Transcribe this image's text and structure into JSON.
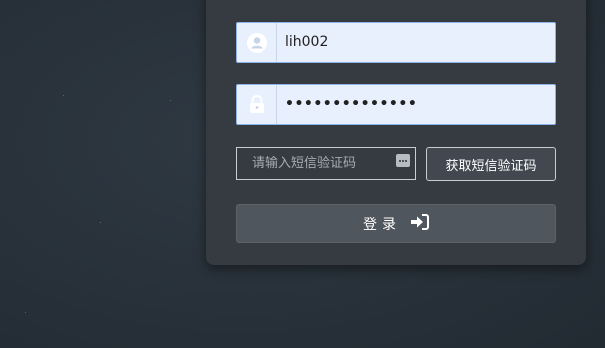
{
  "login_form": {
    "username": {
      "value": "lih002",
      "icon": "user-circle-icon"
    },
    "password": {
      "value": "••••••••••••••",
      "icon": "lock-icon"
    },
    "sms_code": {
      "placeholder": "请输入短信验证码",
      "icon": "keyboard-dots-icon"
    },
    "get_sms_button": {
      "label": "获取短信验证码"
    },
    "login_button": {
      "label": "登录",
      "icon": "sign-in-icon"
    }
  },
  "colors": {
    "background": "#2a323b",
    "panel": "#363b41",
    "input_fill": "#e8f0fe",
    "input_border": "#8cb4e8",
    "icon_fill": "#ffffff",
    "button_fill": "#50565d"
  }
}
